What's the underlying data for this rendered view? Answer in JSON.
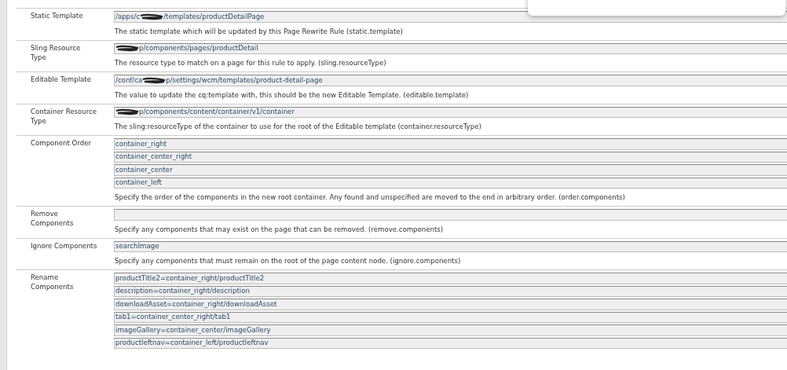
{
  "rows": [
    {
      "label": "Static Template",
      "values": [
        [
          {
            "text": "/apps/c"
          },
          {
            "kind": "redaction"
          },
          {
            "text": "/templates/productDetailPage"
          }
        ]
      ],
      "description": "The static template which will be updated by this Page Rewrite Rule (static.template)"
    },
    {
      "label": "Sling Resource\nType",
      "values": [
        [
          {
            "kind": "redaction"
          },
          {
            "text": "p/components/pages/productDetail"
          }
        ]
      ],
      "description": "The resource type to match on a page for this rule to apply. (sling.resourceType)"
    },
    {
      "label": "Editable Template",
      "values": [
        [
          {
            "text": "/conf/ca"
          },
          {
            "kind": "redaction"
          },
          {
            "text": "p/settings/wcm/templates/product-detail-page"
          }
        ]
      ],
      "description": "The value to update the cq:template with, this should be the new Editable Template. (editable.template)"
    },
    {
      "label": "Container Resource\nType",
      "values": [
        [
          {
            "kind": "redaction"
          },
          {
            "text": "p/components/content/container/v1/container"
          }
        ]
      ],
      "description": "The sling:resourceType of the container to use for the root of the Editable template (container.resourceType)"
    },
    {
      "label": "Component Order",
      "values": [
        [
          {
            "text": "container_right"
          }
        ],
        [
          {
            "text": "container_center_right"
          }
        ],
        [
          {
            "text": "container_center"
          }
        ],
        [
          {
            "text": "container_left"
          }
        ]
      ],
      "description": "Specify the order of the components in the new root container. Any found and unspecified are moved to the end in arbitrary order. (order.components)"
    },
    {
      "label": "Remove\nComponents",
      "description": "Specify any components that may exist on the page that can be removed. (remove.components)"
    },
    {
      "label": "Ignore Components",
      "values": [
        [
          {
            "text": "searchImage"
          }
        ]
      ],
      "description": "Specify any components that must remain on the root of the page content node. (ignore.components)"
    },
    {
      "label": "Rename\nComponents",
      "values": [
        [
          {
            "text": "productTitle2=container_right/productTitle2"
          }
        ],
        [
          {
            "text": "description=container_right/description"
          }
        ],
        [
          {
            "text": "downloadAsset=container_right/downloadAsset"
          }
        ],
        [
          {
            "text": "tab1=container_center_right/tab1"
          }
        ],
        [
          {
            "text": "imageGallery=container_center/imageGallery"
          }
        ],
        [
          {
            "text": "productleftnav=container_left/productleftnav"
          }
        ]
      ]
    }
  ]
}
